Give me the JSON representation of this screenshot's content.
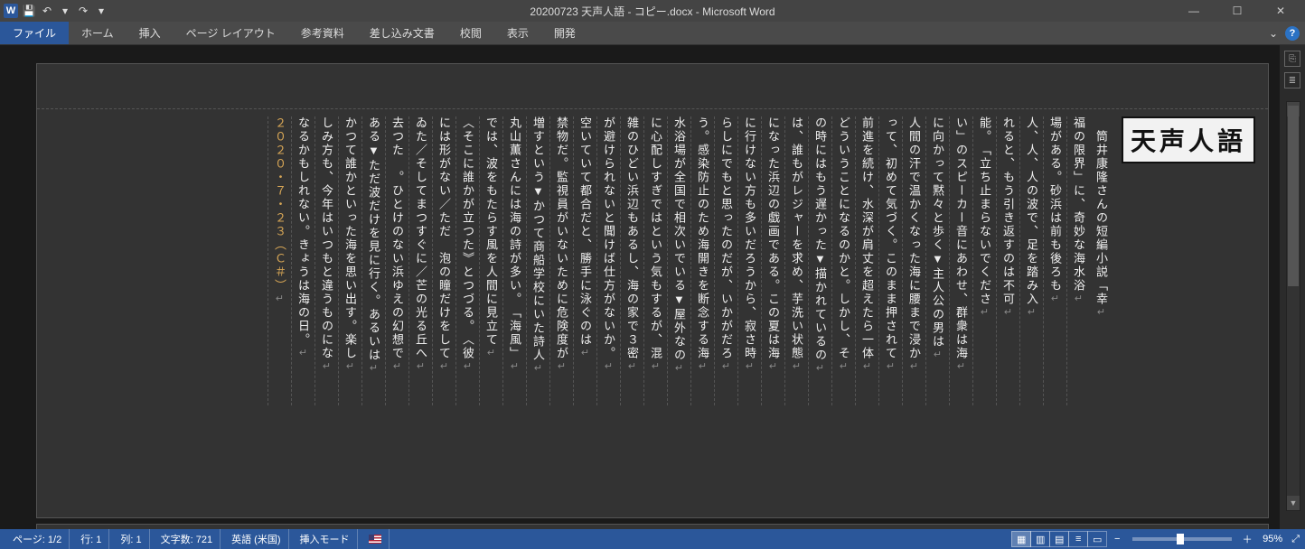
{
  "window": {
    "title": "20200723 天声人語 - コピー.docx - Microsoft Word",
    "minimize": "—",
    "maximize": "☐",
    "close": "✕"
  },
  "qat": {
    "app_letter": "W",
    "save": "💾",
    "undo": "↶",
    "redo": "↷",
    "dropdown": "▾"
  },
  "ribbon": {
    "file": "ファイル",
    "home": "ホーム",
    "insert": "挿入",
    "layout": "ページ レイアウト",
    "references": "参考資料",
    "mailings": "差し込み文書",
    "review": "校閲",
    "view": "表示",
    "developer": "開発",
    "expand": "⌄",
    "help": "?"
  },
  "gutter": {
    "g1": "⎘",
    "g2": "≣"
  },
  "logo": "天声人語",
  "columns": [
    "　筒井康隆さんの短編小説﹁幸",
    "福の限界﹂に︑奇妙な海水浴",
    "場がある︒砂浜は前も後ろも",
    "人︑人︑人の波で︑足を踏み入",
    "れると︑もう引き返すのは不可",
    "能︒﹁立ち止まらないでくださ",
    "い﹂のスピーカー音にあわせ︑群衆は海",
    "に向かって黙々と歩く▼主人公の男は",
    "人間の汗で温かくなった海に腰まで浸か",
    "って︑初めて気づく︒このまま押されて",
    "前進を続け︑水深が肩丈を超えたら一体",
    "どういうことになるのかと︒しかし︑そ",
    "の時にはもう遅かった▼描かれているの",
    "は︑誰もがレジャーを求め︑芋洗い状態",
    "になった浜辺の戯画である︒この夏は海",
    "に行けない方も多いだろうから︑寂さ時",
    "らしにでもと思ったのだが︑いかがだろ",
    "う︒感染防止のため海開きを断念する海",
    "水浴場が全国で相次いでいる▼屋外なの",
    "に心配しすぎではという気もするが︑混",
    "雑のひどい浜辺もあるし︑海の家で３密",
    "が避けられないと聞けば仕方がないか︒",
    "空いていて都合だと︑勝手に泳ぐのは",
    "禁物だ︒監視員がいないために危険度が",
    "増すという▼かつて商船学校にいた詩人",
    "丸山薫さんには海の詩が多い︒﹁海風﹂",
    "では︑波をもたらす風を人間に見立て",
    "︿そこに誰かが立つた︾とつづる︒︿彼",
    "には形がない／ただ　泡の瞳だけをして",
    "ゐた／そしてまつすぐに／芒の光る丘へ",
    "去つた　︒ひとけのない浜ゆえの幻想で",
    "ある▼ただ波だけを見に行く︒あるいは",
    "かつて誰かといった海を思い出す︒楽し",
    "しみ方も︑今年はいつもと違うものにな",
    "なるかもしれない︒きょうは海の日︒",
    "２０２０・７・２３（Ｃ＃）"
  ],
  "status": {
    "page": "ページ: 1/2",
    "line": "行: 1",
    "col": "列: 1",
    "chars": "文字数: 721",
    "lang": "英語 (米国)",
    "insert": "挿入モード",
    "views": {
      "v1": "▦",
      "v2": "▥",
      "v3": "▤",
      "v4": "≡",
      "v5": "▭"
    },
    "zoom_minus": "−",
    "zoom_plus": "＋",
    "zoom": "95%",
    "expand": "⤢"
  }
}
